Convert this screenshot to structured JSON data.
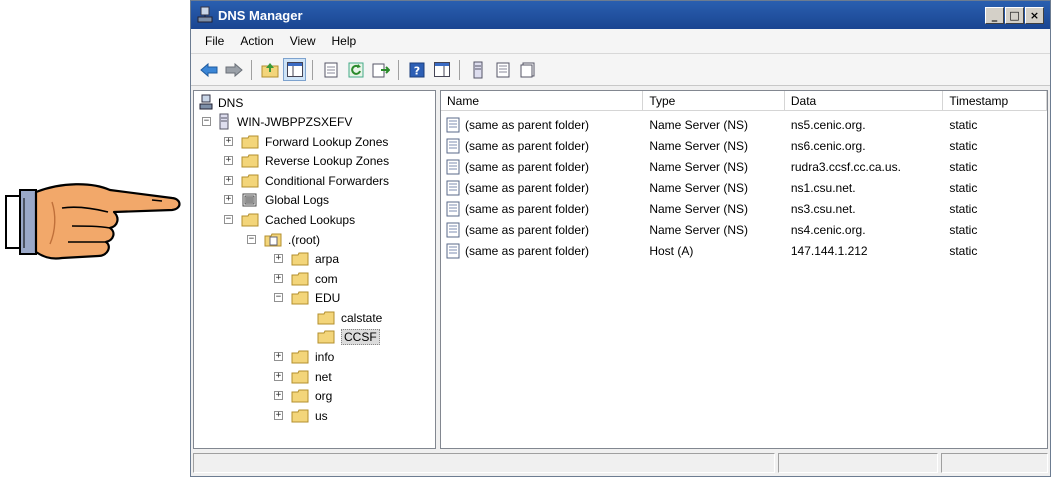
{
  "window": {
    "title": "DNS Manager"
  },
  "menu": [
    "File",
    "Action",
    "View",
    "Help"
  ],
  "toolbar_icons": [
    "back-icon",
    "forward-icon",
    "up-folder-icon",
    "show-hide-tree-icon",
    "properties-icon",
    "refresh-icon",
    "export-list-icon",
    "help-icon",
    "action-pane-icon",
    "server-icon",
    "zone-icon",
    "record-icon"
  ],
  "tree": {
    "root": "DNS",
    "server": "WIN-JWBPPZSXEFV",
    "forward": "Forward Lookup Zones",
    "reverse": "Reverse Lookup Zones",
    "conditional": "Conditional Forwarders",
    "globallogs": "Global Logs",
    "cached": "Cached Lookups",
    "rootzone": ".(root)",
    "arpa": "arpa",
    "com": "com",
    "edu": "EDU",
    "calstate": "calstate",
    "ccsf": "CCSF",
    "info": "info",
    "net": "net",
    "org": "org",
    "us": "us"
  },
  "columns": {
    "name": "Name",
    "type": "Type",
    "data": "Data",
    "timestamp": "Timestamp"
  },
  "records": [
    {
      "name": "(same as parent folder)",
      "type": "Name Server (NS)",
      "data": "ns5.cenic.org.",
      "timestamp": "static"
    },
    {
      "name": "(same as parent folder)",
      "type": "Name Server (NS)",
      "data": "ns6.cenic.org.",
      "timestamp": "static"
    },
    {
      "name": "(same as parent folder)",
      "type": "Name Server (NS)",
      "data": "rudra3.ccsf.cc.ca.us.",
      "timestamp": "static"
    },
    {
      "name": "(same as parent folder)",
      "type": "Name Server (NS)",
      "data": "ns1.csu.net.",
      "timestamp": "static"
    },
    {
      "name": "(same as parent folder)",
      "type": "Name Server (NS)",
      "data": "ns3.csu.net.",
      "timestamp": "static"
    },
    {
      "name": "(same as parent folder)",
      "type": "Name Server (NS)",
      "data": "ns4.cenic.org.",
      "timestamp": "static"
    },
    {
      "name": "(same as parent folder)",
      "type": "Host (A)",
      "data": "147.144.1.212",
      "timestamp": "static"
    }
  ],
  "colors": {
    "titlebar": "#1f4f9e",
    "folder": "#f3d57a",
    "selection": "#dcdcdc"
  }
}
